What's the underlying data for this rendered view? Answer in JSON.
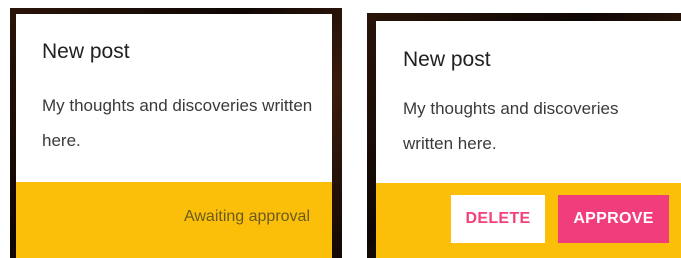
{
  "cards": [
    {
      "title": "New post",
      "body": "My thoughts and discoveries written here.",
      "status": "Awaiting approval"
    },
    {
      "title": "New post",
      "body": "My thoughts and discoveries written here.",
      "actions": {
        "delete_label": "DELETE",
        "approve_label": "APPROVE"
      }
    }
  ],
  "colors": {
    "action_bar": "#fbbf0a",
    "delete_text": "#f4417a",
    "approve_background": "#f23d7c",
    "card_background": "#ffffff",
    "frame_background": "#1a0b05"
  }
}
